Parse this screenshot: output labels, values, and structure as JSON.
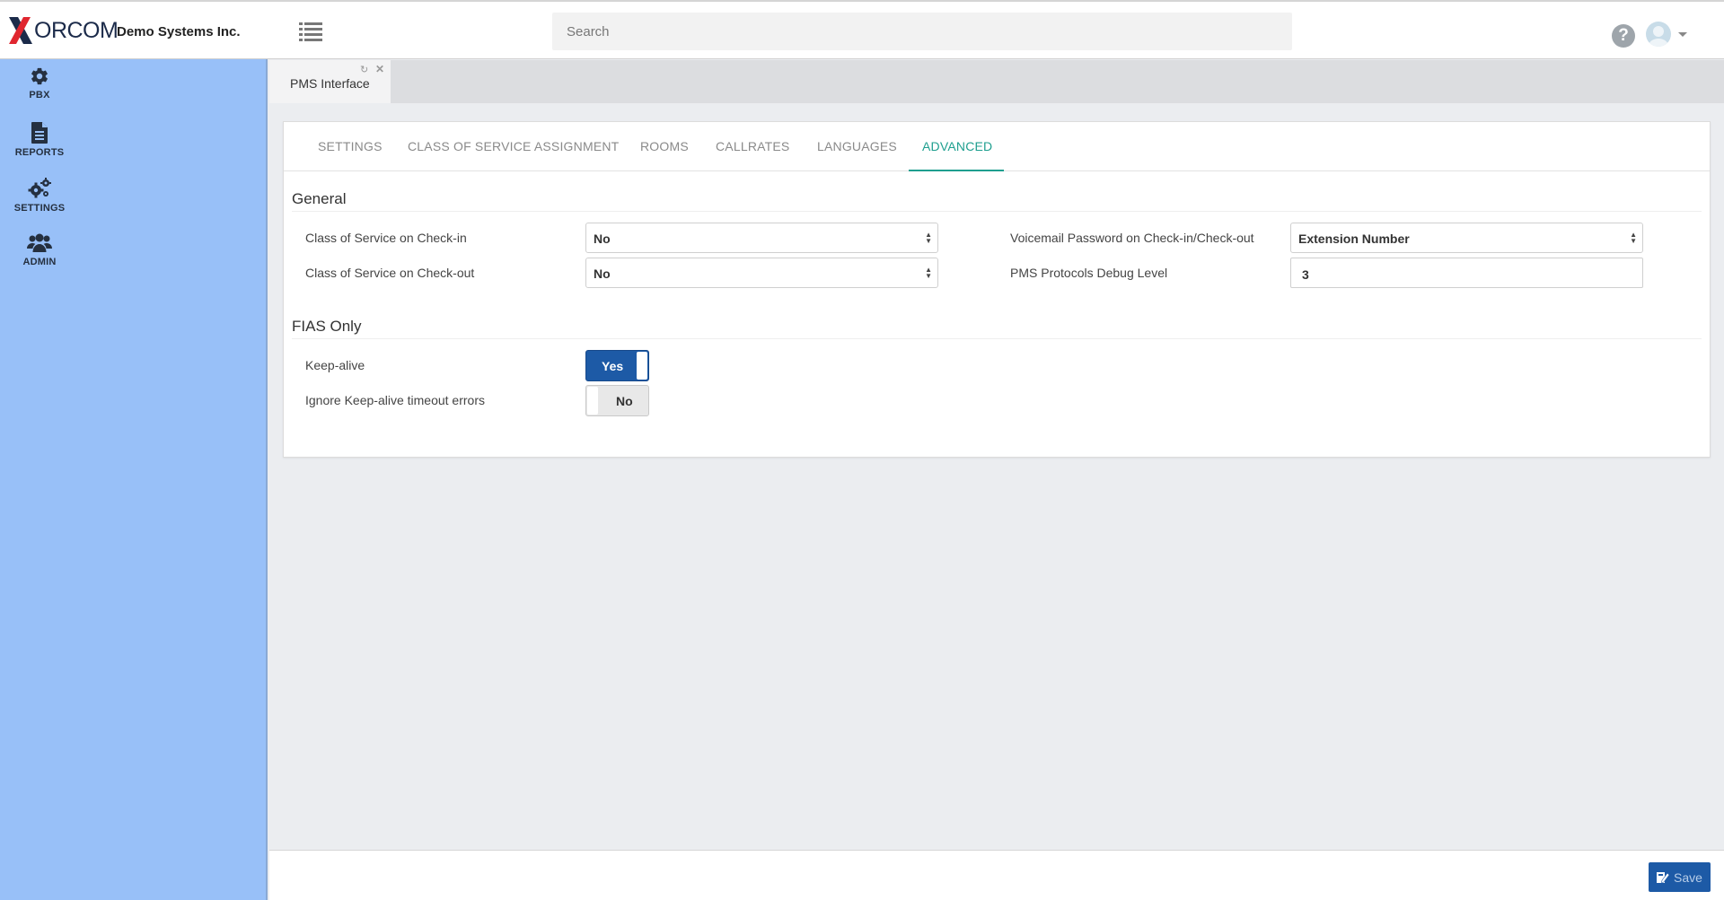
{
  "brand": {
    "logo_text": "ORCOM",
    "logo_letter": "X",
    "company": "Demo Systems Inc."
  },
  "header": {
    "search_placeholder": "Search",
    "help_icon": "question-circle-icon",
    "avatar_icon": "user-avatar-icon"
  },
  "sidebar": {
    "items": [
      {
        "label": "PBX",
        "icon": "gear-icon"
      },
      {
        "label": "REPORTS",
        "icon": "document-icon"
      },
      {
        "label": "SETTINGS",
        "icon": "gears-icon"
      },
      {
        "label": "ADMIN",
        "icon": "users-icon"
      }
    ]
  },
  "window_tab": {
    "title": "PMS Interface"
  },
  "subtabs": [
    {
      "label": "SETTINGS",
      "active": false
    },
    {
      "label": "CLASS OF SERVICE ASSIGNMENT",
      "active": false
    },
    {
      "label": "ROOMS",
      "active": false
    },
    {
      "label": "CALLRATES",
      "active": false
    },
    {
      "label": "LANGUAGES",
      "active": false
    },
    {
      "label": "ADVANCED",
      "active": true
    }
  ],
  "general": {
    "title": "General",
    "cos_checkin": {
      "label": "Class of Service on Check-in",
      "value": "No"
    },
    "cos_checkout": {
      "label": "Class of Service on Check-out",
      "value": "No"
    },
    "vm_password": {
      "label": "Voicemail Password on Check-in/Check-out",
      "value": "Extension Number"
    },
    "debug_level": {
      "label": "PMS Protocols Debug Level",
      "value": "3"
    }
  },
  "fias": {
    "title": "FIAS Only",
    "keep_alive": {
      "label": "Keep-alive",
      "value": "Yes",
      "on": true
    },
    "ignore_timeout": {
      "label": "Ignore Keep-alive timeout errors",
      "value": "No",
      "on": false
    }
  },
  "footer": {
    "save_label": "Save"
  },
  "colors": {
    "sidebar_bg": "#98c0f8",
    "accent_teal": "#1f9f8f",
    "primary_blue": "#1d5aa6",
    "logo_red": "#e0262f",
    "logo_navy": "#1c2b4a"
  }
}
